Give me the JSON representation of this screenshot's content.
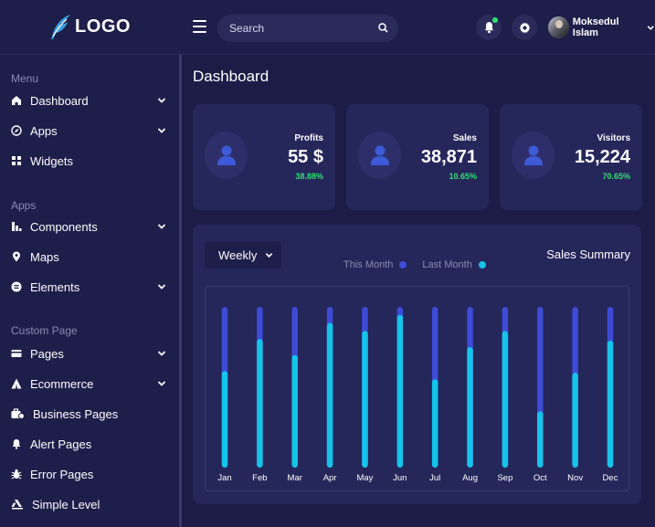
{
  "brand": {
    "logo_text": "LOGO",
    "logo_icon": "feather-icon"
  },
  "sidebar": {
    "sections": [
      {
        "title": "Menu",
        "items": [
          {
            "label": "Dashboard",
            "icon": "home-icon",
            "has_submenu": true
          },
          {
            "label": "Apps",
            "icon": "compass-icon",
            "has_submenu": true
          },
          {
            "label": "Widgets",
            "icon": "grid-icon",
            "has_submenu": false
          }
        ]
      },
      {
        "title": "Apps",
        "items": [
          {
            "label": "Components",
            "icon": "blocks-icon",
            "has_submenu": true
          },
          {
            "label": "Maps",
            "icon": "map-pin-icon",
            "has_submenu": false
          },
          {
            "label": "Elements",
            "icon": "stack-icon",
            "has_submenu": true
          }
        ]
      },
      {
        "title": "Custom Page",
        "items": [
          {
            "label": "Pages",
            "icon": "card-icon",
            "has_submenu": true
          },
          {
            "label": "Ecommerce",
            "icon": "pyramid-icon",
            "has_submenu": true
          },
          {
            "label": "Business Pages",
            "icon": "briefcase-icon",
            "has_submenu": false
          },
          {
            "label": "Alert Pages",
            "icon": "bell-icon",
            "has_submenu": false
          },
          {
            "label": "Error Pages",
            "icon": "bug-icon",
            "has_submenu": false
          },
          {
            "label": "Simple Level",
            "icon": "layers-icon",
            "has_submenu": false
          }
        ]
      }
    ]
  },
  "header": {
    "search_placeholder": "Search",
    "user_name": "Moksedul Islam",
    "notification_badge_color": "#30e070"
  },
  "page_title": "Dashboard",
  "stats": [
    {
      "label": "Profits",
      "value": "55 $",
      "change": "38.88%"
    },
    {
      "label": "Sales",
      "value": "38,871",
      "change": "10.65%"
    },
    {
      "label": "Visitors",
      "value": "15,224",
      "change": "70.65%"
    }
  ],
  "colors": {
    "accent_purple": "#3d4bd6",
    "accent_cyan": "#15c4e8",
    "positive_green": "#30e070"
  },
  "chart_data": {
    "type": "bar",
    "title": "Sales Summary",
    "period": "Weekly",
    "categories": [
      "Jan",
      "Feb",
      "Mar",
      "Apr",
      "May",
      "Jun",
      "Jul",
      "Aug",
      "Sep",
      "Oct",
      "Nov",
      "Dec"
    ],
    "series": [
      {
        "name": "This Month",
        "color": "#3d4bd6",
        "values": [
          100,
          100,
          100,
          100,
          100,
          100,
          100,
          100,
          100,
          100,
          100,
          100
        ]
      },
      {
        "name": "Last Month",
        "color": "#15c4e8",
        "values": [
          60,
          80,
          70,
          90,
          85,
          95,
          55,
          75,
          85,
          35,
          59,
          79
        ]
      }
    ],
    "ylim": [
      0,
      100
    ],
    "grid": false,
    "legend_position": "top-center"
  }
}
